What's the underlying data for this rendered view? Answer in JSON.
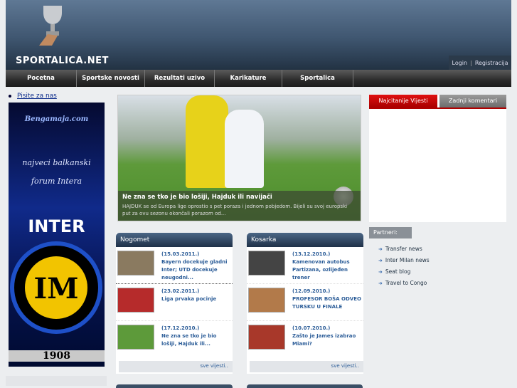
{
  "header": {
    "logo": "SPORTALICA.NET",
    "login": "Login",
    "register": "Registracija"
  },
  "nav": [
    "Pocetna",
    "Sportske novosti",
    "Rezultati uzivo",
    "Karikature",
    "Sportalica"
  ],
  "left": {
    "link": "Pisite za nas",
    "banner": {
      "site": "Bengamaja.com",
      "line1": "najveci balkanski",
      "line2": "forum Intera",
      "club": "INTER",
      "year": "1908"
    }
  },
  "hero": {
    "title": "Ne zna se tko je bio lošiji, Hajduk ili navijači",
    "text": "HAJDUK se od Europa lige oprostio s pet poraza i jednom pobjedom. Bijeli su svoj europski put za ovu sezonu okončali porazom od..."
  },
  "nogomet": {
    "title": "Nogomet",
    "more": "sve vijesti..",
    "items": [
      {
        "date": "(15.03.2011.)",
        "title": "Bayern docekuje gladni Inter; UTD docekuje neugodni..."
      },
      {
        "date": "(23.02.2011.)",
        "title": "Liga prvaka pocinje"
      },
      {
        "date": "(17.12.2010.)",
        "title": "Ne zna se tko je bio lošiji, Hajduk ili..."
      }
    ]
  },
  "kosarka": {
    "title": "Kosarka",
    "more": "sve vijesti..",
    "items": [
      {
        "date": "(13.12.2010.)",
        "title": "Kamenovan autobus Partizana, ozlijeđen trener"
      },
      {
        "date": "(12.09.2010.)",
        "title": "PROFESOR BOŠA ODVEO TURSKU U FINALE"
      },
      {
        "date": "(10.07.2010.)",
        "title": "Zašto je James izabrao Miami?"
      }
    ]
  },
  "right": {
    "tab_active": "Najcitanije Vijesti",
    "tab_inactive": "Zadnji komentari",
    "partners_title": "Partneri:",
    "partners": [
      "Transfer news",
      "Inter Milan news",
      "Seat blog",
      "Travel to Congo"
    ]
  }
}
